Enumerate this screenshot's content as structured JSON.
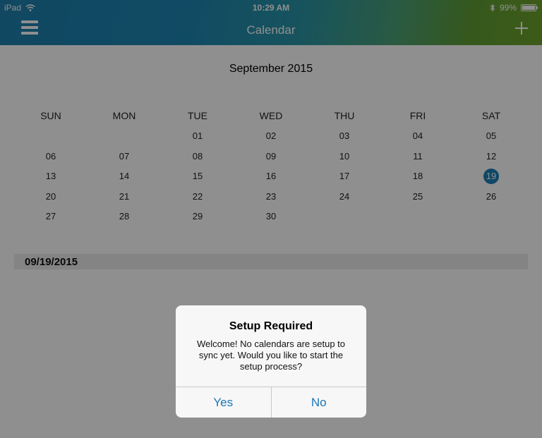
{
  "status_bar": {
    "device": "iPad",
    "time": "10:29 AM",
    "battery": "99%",
    "battery_level": 0.99
  },
  "nav": {
    "title": "Calendar",
    "menu_icon": "hamburger-icon",
    "add_icon": "plus-icon"
  },
  "calendar": {
    "month_title": "September 2015",
    "weekdays": [
      "SUN",
      "MON",
      "TUE",
      "WED",
      "THU",
      "FRI",
      "SAT"
    ],
    "days": [
      "",
      "",
      "01",
      "02",
      "03",
      "04",
      "05",
      "06",
      "07",
      "08",
      "09",
      "10",
      "11",
      "12",
      "13",
      "14",
      "15",
      "16",
      "17",
      "18",
      "19",
      "20",
      "21",
      "22",
      "23",
      "24",
      "25",
      "26",
      "27",
      "28",
      "29",
      "30",
      "",
      "",
      ""
    ],
    "selected_day": "19",
    "selected_date": "09/19/2015"
  },
  "alert": {
    "title": "Setup Required",
    "message": "Welcome! No calendars are setup to sync yet.  Would you like to start the setup process?",
    "yes_label": "Yes",
    "no_label": "No"
  },
  "colors": {
    "accent": "#1c7fb6",
    "nav_gradient_start": "#1f7fae",
    "nav_gradient_end": "#6ea22a"
  }
}
